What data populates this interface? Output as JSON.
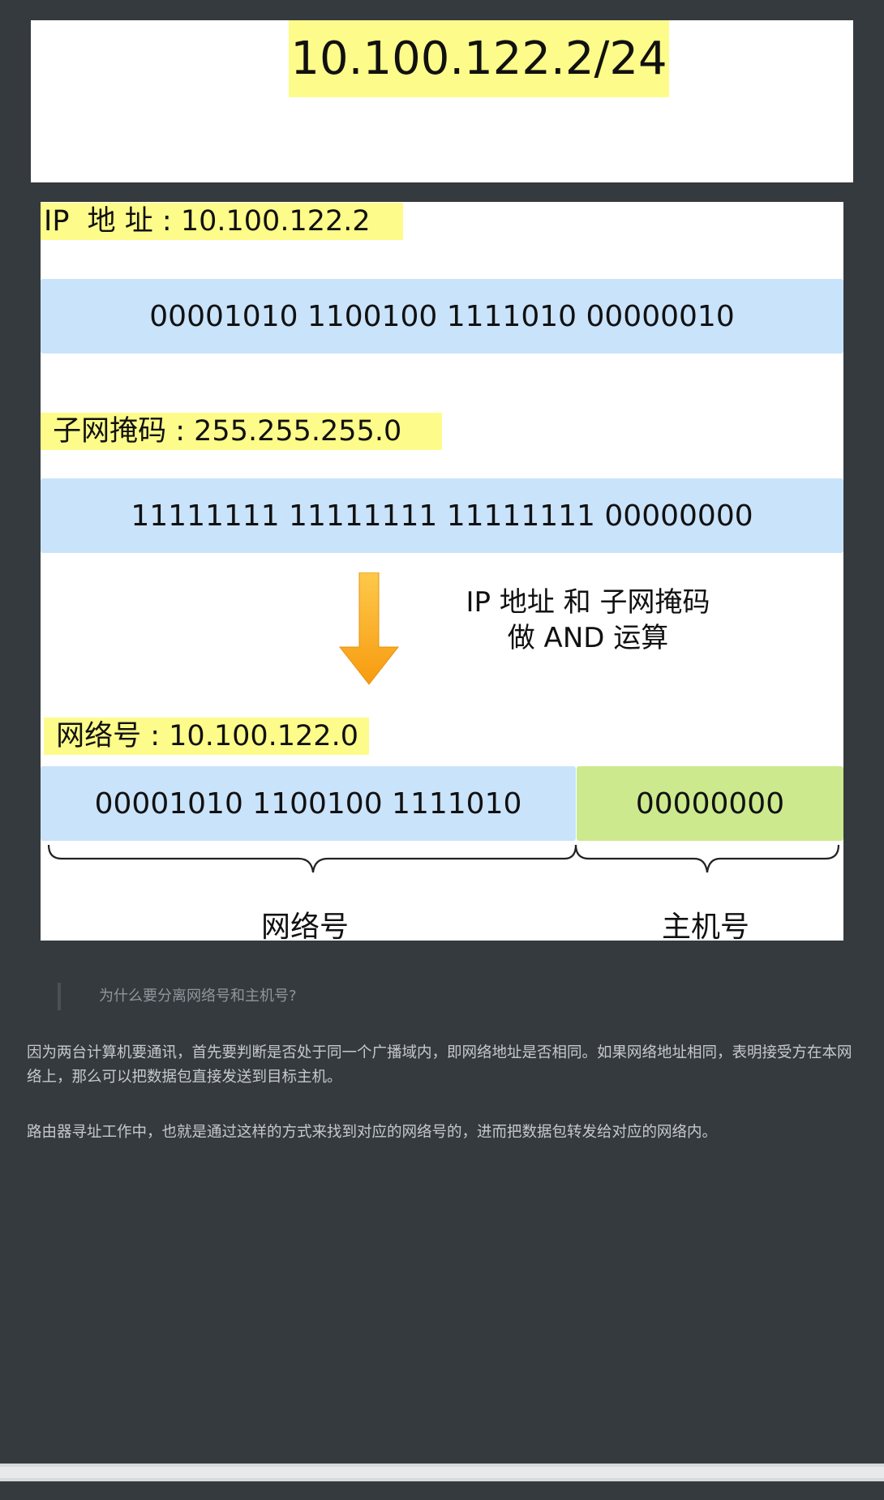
{
  "figure1": {
    "cidr": "10.100.122.2/24"
  },
  "figure2": {
    "ip_label": "IP  地 址 : 10.100.122.2",
    "ip_binary": "00001010 1100100 1111010 00000010",
    "mask_label": " 子网掩码 : 255.255.255.0",
    "mask_binary": "11111111 11111111 11111111 00000000",
    "op_note_line1": "IP 地址 和 子网掩码",
    "op_note_line2": "做 AND 运算",
    "network_label": " 网络号 : 10.100.122.0",
    "network_binary": "00001010 1100100 1111010",
    "host_binary": "00000000",
    "network_part_label": "网络号",
    "host_part_label": "主机号",
    "colors": {
      "highlight": "#fdfc8a",
      "band_blue": "#c9e3fb",
      "band_green": "#cce98e",
      "arrow": "#fbb12a"
    }
  },
  "article": {
    "quote": "为什么要分离网络号和主机号?",
    "paragraph1": "因为两台计算机要通讯，首先要判断是否处于同一个广播域内，即网络地址是否相同。如果网络地址相同，表明接受方在本网络上，那么可以把数据包直接发送到目标主机。",
    "paragraph2": "路由器寻址工作中，也就是通过这样的方式来找到对应的网络号的，进而把数据包转发给对应的网络内。"
  },
  "icons": [
    "down-arrow-icon",
    "curly-brace-icon"
  ]
}
